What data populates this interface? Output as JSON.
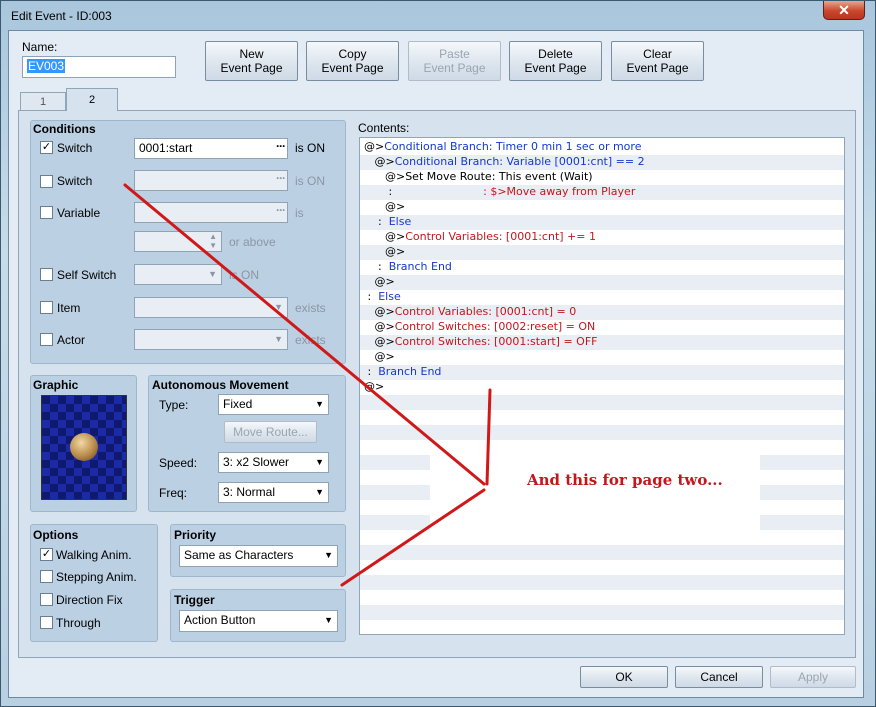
{
  "window": {
    "title": "Edit Event - ID:003",
    "close": "✕"
  },
  "name": {
    "label": "Name:",
    "value": "EV003"
  },
  "toolbar": {
    "new": [
      "New",
      "Event Page"
    ],
    "copy": [
      "Copy",
      "Event Page"
    ],
    "paste": [
      "Paste",
      "Event Page"
    ],
    "delete": [
      "Delete",
      "Event Page"
    ],
    "clear": [
      "Clear",
      "Event Page"
    ]
  },
  "tabs": [
    "1",
    "2"
  ],
  "conditions": {
    "heading": "Conditions",
    "switch1": {
      "label": "Switch",
      "value": "0001:start",
      "suffix": "is ON",
      "checked": true
    },
    "switch2": {
      "label": "Switch",
      "suffix": "is ON"
    },
    "variable": {
      "label": "Variable",
      "suffix": "is",
      "suffix2": "or above"
    },
    "selfswitch": {
      "label": "Self Switch",
      "suffix": "is ON"
    },
    "item": {
      "label": "Item",
      "suffix": "exists"
    },
    "actor": {
      "label": "Actor",
      "suffix": "exists"
    }
  },
  "graphic": {
    "heading": "Graphic"
  },
  "movement": {
    "heading": "Autonomous Movement",
    "type_label": "Type:",
    "type": "Fixed",
    "move_route": "Move Route...",
    "speed_label": "Speed:",
    "speed": "3: x2 Slower",
    "freq_label": "Freq:",
    "freq": "3: Normal"
  },
  "options": {
    "heading": "Options",
    "walking": "Walking Anim.",
    "stepping": "Stepping Anim.",
    "direction": "Direction Fix",
    "through": "Through"
  },
  "priority": {
    "heading": "Priority",
    "value": "Same as Characters"
  },
  "trigger": {
    "heading": "Trigger",
    "value": "Action Button"
  },
  "contents": {
    "label": "Contents:",
    "lines": [
      {
        "ind": "",
        "pre": "@>",
        "text": "Conditional Branch: Timer 0 min 1 sec or more",
        "c": "blue"
      },
      {
        "ind": "   ",
        "pre": "@>",
        "text": "Conditional Branch: Variable [0001:cnt] == 2",
        "c": "blue"
      },
      {
        "ind": "      ",
        "pre": "@>",
        "text": "Set Move Route: This event (Wait)",
        "c": "black"
      },
      {
        "ind": "       ",
        "pre": ":",
        "text": "                          : $>Move away from Player",
        "c": "red"
      },
      {
        "ind": "      ",
        "pre": "@>",
        "text": "",
        "c": "black"
      },
      {
        "ind": "    ",
        "pre": ":  ",
        "text": "Else",
        "c": "blue"
      },
      {
        "ind": "      ",
        "pre": "@>",
        "text": "Control Variables: [0001:cnt] += 1",
        "c": "red"
      },
      {
        "ind": "      ",
        "pre": "@>",
        "text": "",
        "c": "black"
      },
      {
        "ind": "    ",
        "pre": ":  ",
        "text": "Branch End",
        "c": "blue"
      },
      {
        "ind": "   ",
        "pre": "@>",
        "text": "",
        "c": "black"
      },
      {
        "ind": " ",
        "pre": ":  ",
        "text": "Else",
        "c": "blue"
      },
      {
        "ind": "   ",
        "pre": "@>",
        "text": "Control Variables: [0001:cnt] = 0",
        "c": "red"
      },
      {
        "ind": "   ",
        "pre": "@>",
        "text": "Control Switches: [0002:reset] = ON",
        "c": "red"
      },
      {
        "ind": "   ",
        "pre": "@>",
        "text": "Control Switches: [0001:start] = OFF",
        "c": "red"
      },
      {
        "ind": "   ",
        "pre": "@>",
        "text": "",
        "c": "black"
      },
      {
        "ind": " ",
        "pre": ":  ",
        "text": "Branch End",
        "c": "blue"
      },
      {
        "ind": "",
        "pre": "@>",
        "text": "",
        "c": "black"
      }
    ]
  },
  "annotation": "And this for page two...",
  "buttons": {
    "ok": "OK",
    "cancel": "Cancel",
    "apply": "Apply"
  },
  "colors": {
    "blue": "#1538d0",
    "red": "#c4161c",
    "arrow": "#d01818"
  }
}
